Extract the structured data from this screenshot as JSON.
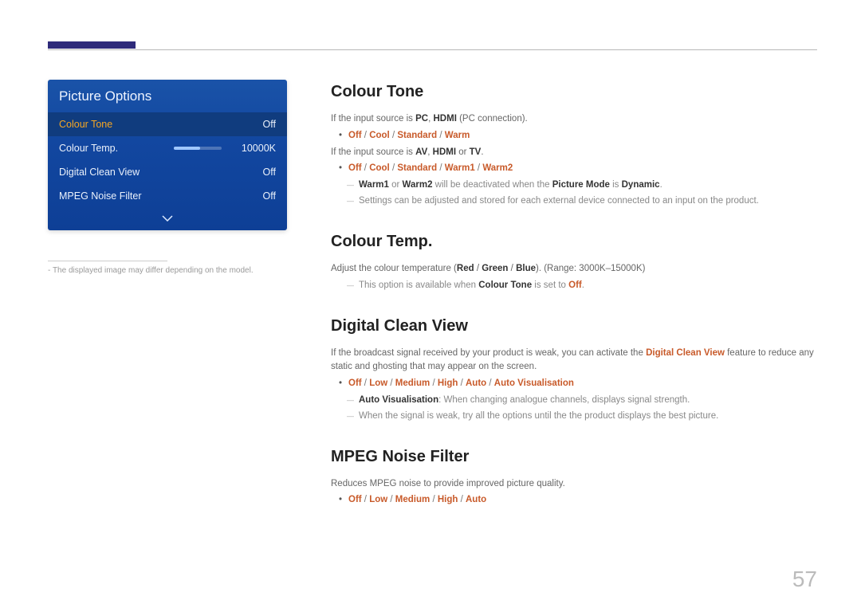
{
  "page_number": "57",
  "panel": {
    "title": "Picture Options",
    "rows": [
      {
        "label": "Colour Tone",
        "value": "Off"
      },
      {
        "label": "Colour Temp.",
        "value": "10000K"
      },
      {
        "label": "Digital Clean View",
        "value": "Off"
      },
      {
        "label": "MPEG Noise Filter",
        "value": "Off"
      }
    ]
  },
  "caption_prefix": "-",
  "caption": "The displayed image may differ depending on the model.",
  "sections": {
    "colour_tone": {
      "heading": "Colour Tone",
      "line1_pre": "If the input source is ",
      "line1_b1": "PC",
      "line1_sep": ", ",
      "line1_b2": "HDMI",
      "line1_post": " (PC connection).",
      "opts1": {
        "o1": "Off",
        "o2": "Cool",
        "o3": "Standard",
        "o4": "Warm"
      },
      "line2_pre": "If the input source is ",
      "line2_b1": "AV",
      "line2_b2": "HDMI",
      "line2_or": " or ",
      "line2_b3": "TV",
      "opts2": {
        "o1": "Off",
        "o2": "Cool",
        "o3": "Standard",
        "o4": "Warm1",
        "o5": "Warm2"
      },
      "dash1_b1": "Warm1",
      "dash1_or": " or ",
      "dash1_b2": "Warm2",
      "dash1_mid": " will be deactivated when the ",
      "dash1_b3": "Picture Mode",
      "dash1_is": " is ",
      "dash1_b4": "Dynamic",
      "dash1_end": ".",
      "dash2": "Settings can be adjusted and stored for each external device connected to an input on the product."
    },
    "colour_temp": {
      "heading": "Colour Temp.",
      "line1_pre": "Adjust the colour temperature (",
      "r": "Red",
      "g": "Green",
      "b": "Blue",
      "line1_post": "). (Range: 3000K–15000K)",
      "dash_pre": "This option is available when ",
      "dash_b": "Colour Tone",
      "dash_mid": " is set to ",
      "dash_o": "Off",
      "dash_end": "."
    },
    "dcv": {
      "heading": "Digital Clean View",
      "para_pre": "If the broadcast signal received by your product is weak, you can activate the ",
      "para_b": "Digital Clean View",
      "para_post": " feature to reduce any static and ghosting that may appear on the screen.",
      "opts": {
        "o1": "Off",
        "o2": "Low",
        "o3": "Medium",
        "o4": "High",
        "o5": "Auto",
        "o6": "Auto Visualisation"
      },
      "dash1_b": "Auto Visualisation",
      "dash1_post": ": When changing analogue channels, displays signal strength.",
      "dash2": "When the signal is weak, try all the options until the the product displays the best picture."
    },
    "mpeg": {
      "heading": "MPEG Noise Filter",
      "para": "Reduces MPEG noise to provide improved picture quality.",
      "opts": {
        "o1": "Off",
        "o2": "Low",
        "o3": "Medium",
        "o4": "High",
        "o5": "Auto"
      }
    }
  }
}
